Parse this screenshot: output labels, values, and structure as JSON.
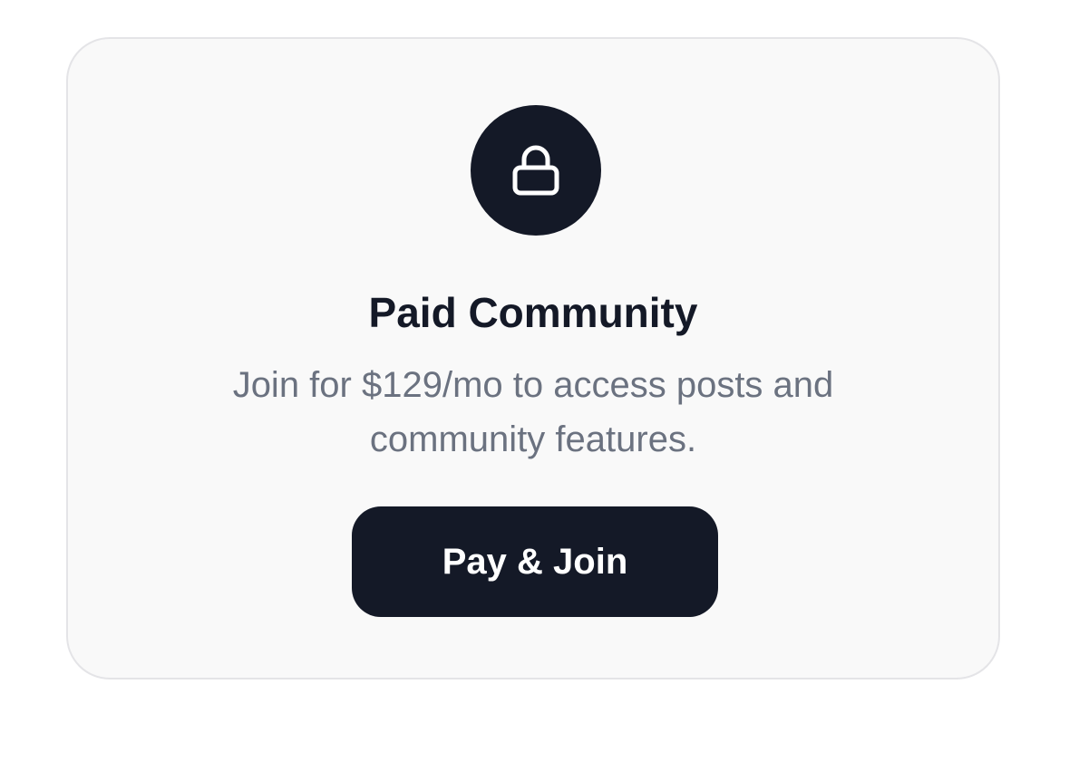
{
  "card": {
    "icon": "lock-icon",
    "title": "Paid Community",
    "description": "Join for $129/mo to access posts and community features.",
    "cta_label": "Pay & Join"
  },
  "colors": {
    "primary": "#141927",
    "card_background": "#f9f9f9",
    "card_border": "#e4e4e7",
    "muted_text": "#6b7280"
  }
}
